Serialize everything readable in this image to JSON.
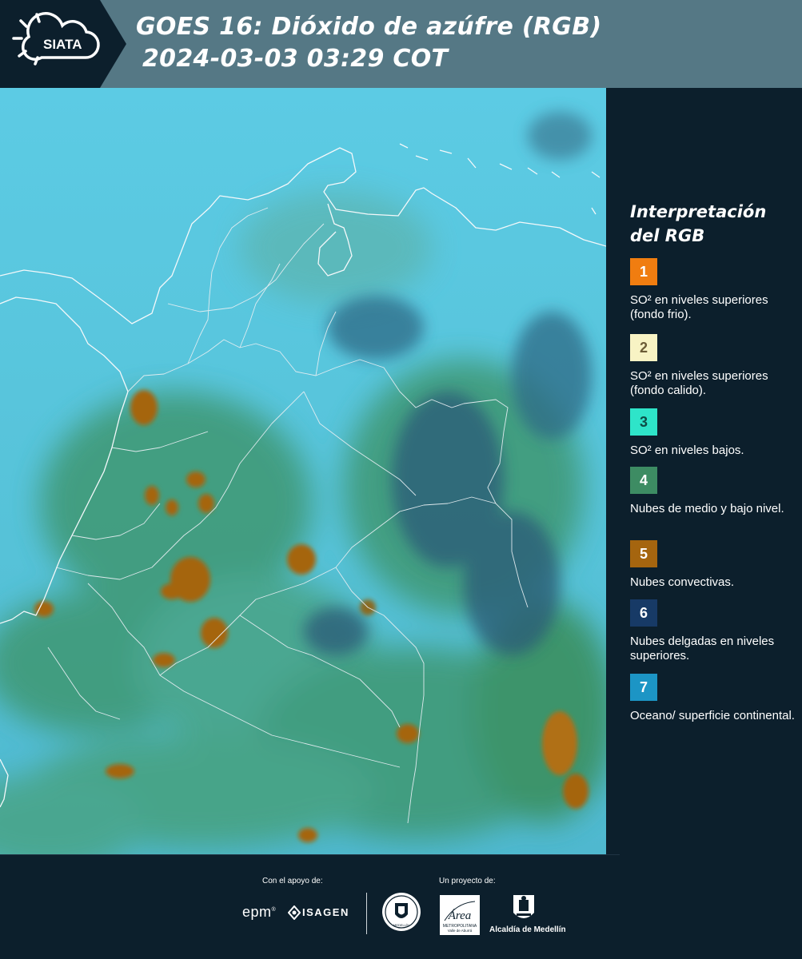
{
  "header": {
    "logo_text": "SIATA",
    "title_line1": "GOES 16: Dióxido de azúfre (RGB)",
    "title_line2": "2024-03-03 03:29 COT"
  },
  "legend": {
    "title_line1": "Interpretación",
    "title_line2": "del RGB",
    "items": [
      {
        "number": "1",
        "color": "#f07d10",
        "number_color": "#ffffff",
        "text": "SO² en niveles superiores (fondo frio)."
      },
      {
        "number": "2",
        "color": "#f8f3c4",
        "number_color": "#6b5b36",
        "text": "SO² en niveles superiores (fondo calido)."
      },
      {
        "number": "3",
        "color": "#2ee4c9",
        "number_color": "#0e4b46",
        "text": "SO² en niveles bajos."
      },
      {
        "number": "4",
        "color": "#3d8c63",
        "number_color": "#ffffff",
        "text": "Nubes de medio y bajo nivel."
      },
      {
        "number": "5",
        "color": "#a5650f",
        "number_color": "#ffffff",
        "text": "Nubes convectivas."
      },
      {
        "number": "6",
        "color": "#173a66",
        "number_color": "#ffffff",
        "text": "Nubes delgadas en niveles superiores."
      },
      {
        "number": "7",
        "color": "#1c95c5",
        "number_color": "#ffffff",
        "text": "Oceano/ superficie continental."
      }
    ]
  },
  "footer": {
    "support_label": "Con el apoyo de:",
    "project_label": "Un proyecto de:",
    "epm": "epm",
    "isagen": "ISAGEN",
    "area_name": "Área",
    "area_sub1": "METROPOLITANA",
    "area_sub2": "Valle de Aburrá",
    "alcaldia": "Alcaldía de Medellín",
    "seal_text": "MEDELLÍN"
  }
}
